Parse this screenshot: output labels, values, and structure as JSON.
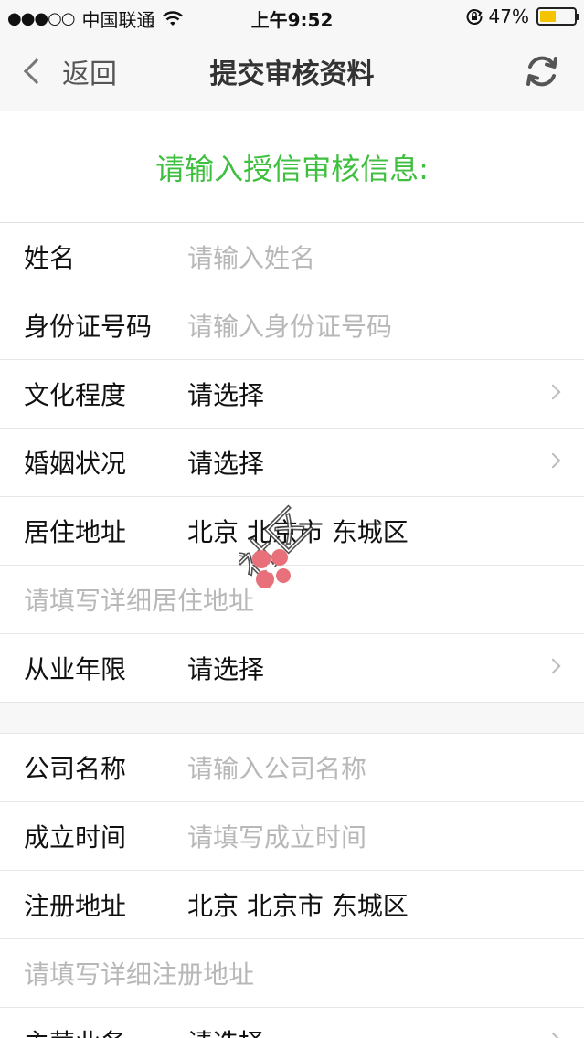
{
  "status_bar": {
    "signal": "●●●○○",
    "carrier": "中国联通",
    "time": "上午9:52",
    "battery_text": "47%",
    "battery_level": 0.47
  },
  "nav": {
    "back_label": "返回",
    "title": "提交审核资料"
  },
  "prompt": "请输入授信审核信息:",
  "section1": [
    {
      "label": "姓名",
      "value": "请输入姓名",
      "placeholder": true,
      "arrow": false
    },
    {
      "label": "身份证号码",
      "value": "请输入身份证号码",
      "placeholder": true,
      "arrow": false
    },
    {
      "label": "文化程度",
      "value": "请选择",
      "placeholder": false,
      "arrow": true
    },
    {
      "label": "婚姻状况",
      "value": "请选择",
      "placeholder": false,
      "arrow": true
    },
    {
      "label": "居住地址",
      "value": "北京 北京市 东城区",
      "placeholder": false,
      "arrow": false
    },
    {
      "label": "",
      "value": "请填写详细居住地址",
      "placeholder": true,
      "arrow": false,
      "full": true
    },
    {
      "label": "从业年限",
      "value": "请选择",
      "placeholder": false,
      "arrow": true
    }
  ],
  "section2": [
    {
      "label": "公司名称",
      "value": "请输入公司名称",
      "placeholder": true,
      "arrow": false
    },
    {
      "label": "成立时间",
      "value": "请填写成立时间",
      "placeholder": true,
      "arrow": false
    },
    {
      "label": "注册地址",
      "value": "北京 北京市 东城区",
      "placeholder": false,
      "arrow": false
    },
    {
      "label": "",
      "value": "请填写详细注册地址",
      "placeholder": true,
      "arrow": false,
      "full": true
    },
    {
      "label": "主营业务",
      "value": "请选择",
      "placeholder": false,
      "arrow": true
    }
  ],
  "watermark_text": "社区"
}
